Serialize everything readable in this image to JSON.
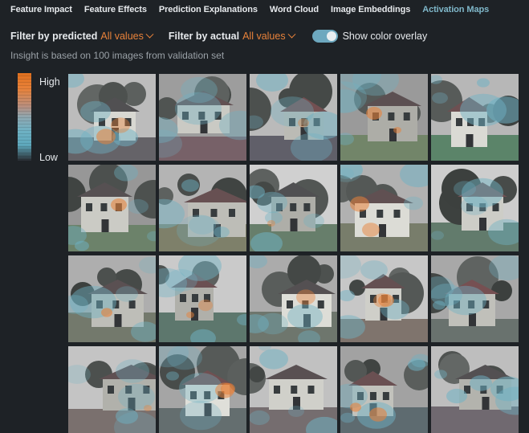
{
  "tabs": [
    {
      "label": "Feature Impact",
      "active": false
    },
    {
      "label": "Feature Effects",
      "active": false
    },
    {
      "label": "Prediction Explanations",
      "active": false
    },
    {
      "label": "Word Cloud",
      "active": false
    },
    {
      "label": "Image Embeddings",
      "active": false
    },
    {
      "label": "Activation Maps",
      "active": true
    }
  ],
  "filters": {
    "predicted_label": "Filter by predicted",
    "predicted_value": "All values",
    "actual_label": "Filter by actual",
    "actual_value": "All values",
    "overlay_label": "Show color overlay",
    "overlay_on": true
  },
  "insight_text": "Insight is based on 100 images from validation set",
  "legend": {
    "high": "High",
    "low": "Low"
  },
  "colors": {
    "accent_orange": "#e8823a",
    "accent_teal": "#6fb2c4",
    "background": "#1e2226",
    "active_tab": "#7fb7c9"
  },
  "images": [
    {
      "row": 1,
      "col": 1
    },
    {
      "row": 1,
      "col": 2
    },
    {
      "row": 1,
      "col": 3
    },
    {
      "row": 1,
      "col": 4
    },
    {
      "row": 1,
      "col": 5
    },
    {
      "row": 2,
      "col": 1
    },
    {
      "row": 2,
      "col": 2
    },
    {
      "row": 2,
      "col": 3
    },
    {
      "row": 2,
      "col": 4
    },
    {
      "row": 2,
      "col": 5
    },
    {
      "row": 3,
      "col": 1
    },
    {
      "row": 3,
      "col": 2
    },
    {
      "row": 3,
      "col": 3
    },
    {
      "row": 3,
      "col": 4
    },
    {
      "row": 3,
      "col": 5
    },
    {
      "row": 4,
      "col": 1
    },
    {
      "row": 4,
      "col": 2
    },
    {
      "row": 4,
      "col": 3
    },
    {
      "row": 4,
      "col": 4
    },
    {
      "row": 4,
      "col": 5
    }
  ]
}
